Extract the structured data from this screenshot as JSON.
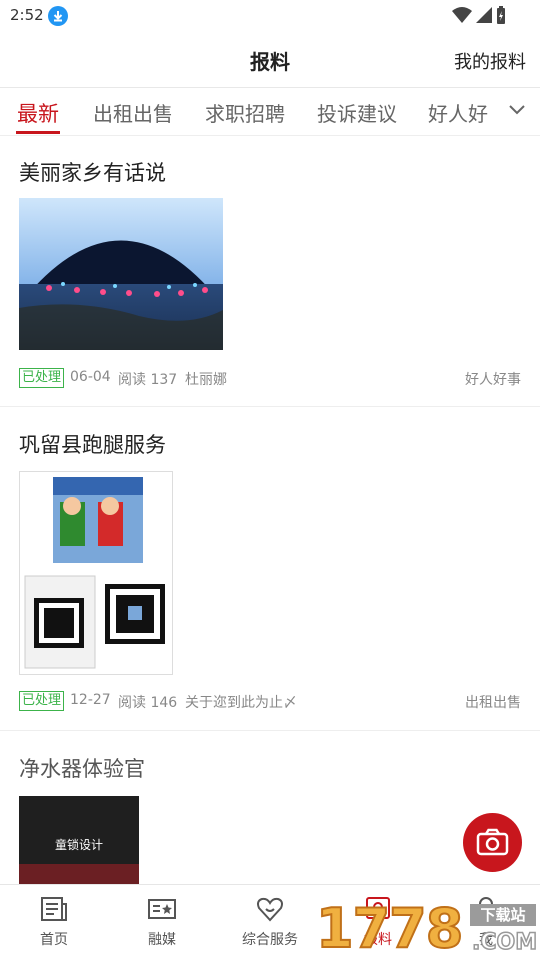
{
  "status": {
    "time": "2:52"
  },
  "header": {
    "title": "报料",
    "my_reports": "我的报料"
  },
  "tabs": [
    {
      "label": "最新",
      "active": true
    },
    {
      "label": "出租出售"
    },
    {
      "label": "求职招聘"
    },
    {
      "label": "投诉建议"
    },
    {
      "label": "好人好"
    }
  ],
  "posts": [
    {
      "title": "美丽家乡有话说",
      "status": "已处理",
      "date": "06-04",
      "reads": "阅读 137",
      "author": "杜丽娜",
      "category": "好人好事"
    },
    {
      "title": "巩留县跑腿服务",
      "status": "已处理",
      "date": "12-27",
      "reads": "阅读 146",
      "author": "关于迩到此为止〆",
      "category": "出租出售"
    },
    {
      "title": "净水器体验官",
      "image_caption": "童锁设计"
    }
  ],
  "bottom_nav": [
    {
      "label": "首页",
      "icon": "news-icon"
    },
    {
      "label": "融媒",
      "icon": "media-icon"
    },
    {
      "label": "综合服务",
      "icon": "heart-icon"
    },
    {
      "label": "报料",
      "icon": "report-icon",
      "active": true
    },
    {
      "label": "我",
      "icon": "user-icon"
    }
  ],
  "watermark": {
    "text": "1778",
    "tag": "下载站",
    "domain": ".COM"
  },
  "colors": {
    "accent": "#c8161d",
    "status_green": "#3cb34a"
  }
}
